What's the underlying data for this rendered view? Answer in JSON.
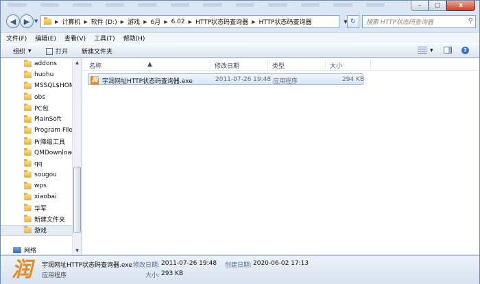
{
  "window": {
    "controls": {
      "minimize": "–",
      "maximize": "□",
      "close": "x"
    }
  },
  "address": {
    "crumbs": [
      "计算机",
      "软件 (D:)",
      "游戏",
      "6月",
      "6.02",
      "HTTP状态码查询器",
      "HTTP状态码查询器"
    ],
    "search_placeholder": "搜索 HTTP状态码查询器"
  },
  "menu": [
    "文件(F)",
    "编辑(E)",
    "查看(V)",
    "工具(T)",
    "帮助(H)"
  ],
  "toolbar": {
    "organize": "组织",
    "open": "打开",
    "new_folder": "新建文件夹"
  },
  "nav": {
    "items": [
      "addons",
      "huohu",
      "MSSQL$HOM",
      "obs",
      "PC包",
      "PlainSoft",
      "Program Files",
      "Pr降级工具",
      "QMDownload",
      "qq",
      "sougou",
      "wps",
      "xiaobai",
      "华军",
      "新建文件夹",
      "游戏"
    ],
    "selected_index": 15,
    "network": "网络"
  },
  "columns": {
    "name": "名称",
    "modified": "修改日期",
    "type": "类型",
    "size": "大小"
  },
  "files": [
    {
      "name": "宇润网址HTTP状态码查询器.exe",
      "modified": "2011-07-26 19:48",
      "type": "应用程序",
      "size": "294 KB"
    }
  ],
  "details": {
    "filename": "宇润网址HTTP状态码查询器.exe",
    "filetype": "应用程序",
    "modified_label": "修改日期:",
    "modified": "2011-07-26 19:48",
    "created_label": "创建日期:",
    "created": "2020-06-02 17:13",
    "size_label": "大小:",
    "size": "293 KB"
  },
  "icons": {
    "app_glyph": "润"
  }
}
